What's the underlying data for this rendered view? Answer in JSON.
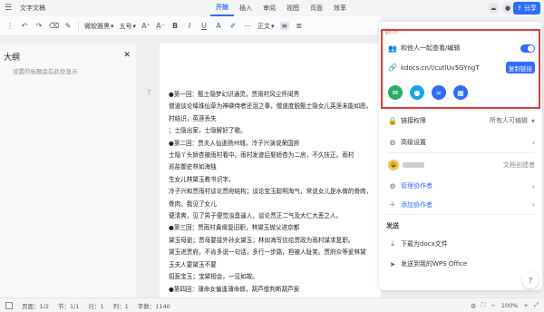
{
  "topbar": {
    "doc_title": "文字文稿",
    "menus": [
      "开始",
      "插入",
      "审阅",
      "视图",
      "页面",
      "效率"
    ],
    "active_menu": "开始",
    "share_label": "分享"
  },
  "toolbar": {
    "font_name": "微软雅黑",
    "font_size": "五号",
    "para_style": "正文"
  },
  "outline": {
    "title": "大纲",
    "hint": "设置的标题会在此处显示"
  },
  "document": {
    "lines": [
      "●第一回：甄士隐梦幻识通灵，贾雨村风尘怀闺秀",
      "僧道谈论绛珠仙草为神瑛侍者还泪之事，僧道度脱甄士隐女儿英莲未能如愿。",
      "村结识，英莲丢失",
      "；士隐出家，士隐解好了歌。",
      "●第二回：贾夫人仙逝扬州城，冷子兴演说荣国府",
      "士隐丫头娇杏被雨村看中。雨村发迹后娶娇杏为二房，不久扶正。雨村",
      "巡盐御史林如海独",
      "生女儿林黛玉教书识字。",
      "冷子兴和贾雨村谈论贾府结构；谈论宝玉聪明淘气，常说女儿是水做的骨肉，",
      "骨肉，我见了女儿",
      "便清爽，见了男子便觉浊臭逼人，谈论贾正二气及大仁大恶之人。",
      "●第三回：贾雨村夤缘复旧职，林黛玉抛父进京都",
      "黛玉母逝；贾母要接外孙女黛玉；林如海写信给贾政为雨村谋求复职。",
      "黛玉进贾府，不肯多说一句话，多行一步路，担被人耻笑。贾府众等爱林黛",
      "玉夫人要黛玉不要",
      "招惹宝玉；宝黛相会，一见如故。",
      "●第四回：薄命女偏逢薄命郎，葫芦僧判断葫芦案"
    ]
  },
  "statusbar": {
    "page": "页面：1/2",
    "section": "节：1/1",
    "row": "行：1",
    "col": "列：1",
    "words": "字数：1140",
    "zoom": "100%"
  },
  "panel": {
    "section_title": "协作",
    "collab_label": "和他人一起查看/编辑",
    "link": "kdocs.cn/l/cutlUv5GYngT",
    "copy_label": "复制链接",
    "share_icons": [
      "wechat-icon",
      "qq-icon",
      "link-icon",
      "apps-icon"
    ],
    "link_permission_label": "链接权限",
    "link_permission_value": "所有人可编辑",
    "advanced_label": "高级设置",
    "creator_role": "文档创建者",
    "manage_label": "管理协作者",
    "add_label": "添加协作者",
    "send_section": "发送",
    "download_label": "下载为docx文件",
    "send_wps_label": "发送到我的WPS Office"
  },
  "colors": {
    "accent": "#2f6bff",
    "highlight_border": "#e03b3b",
    "wechat": "#2aae67",
    "qq": "#1aa3e8"
  }
}
